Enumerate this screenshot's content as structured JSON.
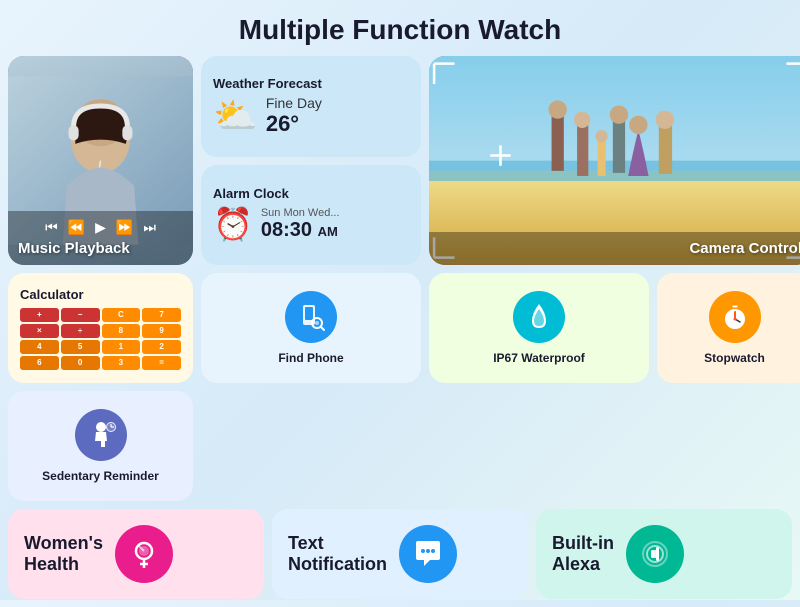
{
  "page": {
    "title": "Multiple Function Watch",
    "bg_color": "#e8f4fd"
  },
  "weather": {
    "title": "Weather Forecast",
    "condition": "Fine Day",
    "temperature": "26°",
    "icon": "⛅"
  },
  "alarm": {
    "title": "Alarm Clock",
    "days": "Sun Mon Wed...",
    "time": "08:30",
    "period": "AM",
    "icon": "⏰"
  },
  "music": {
    "label": "Music Playback",
    "controls": [
      "⏮",
      "⏪",
      "▶",
      "⏩",
      "⏭"
    ]
  },
  "camera": {
    "label": "Camera Control"
  },
  "calculator": {
    "title": "Calculator"
  },
  "find_phone": {
    "label": "Find Phone"
  },
  "waterproof": {
    "label": "IP67 Waterproof"
  },
  "stopwatch": {
    "label": "Stopwatch"
  },
  "sedentary": {
    "label": "Sedentary Reminder"
  },
  "womens_health": {
    "label_line1": "Women's",
    "label_line2": "Health"
  },
  "text_notification": {
    "label_line1": "Text",
    "label_line2": "Notification"
  },
  "builtin_alexa": {
    "label_line1": "Built-in",
    "label_line2": "Alexa"
  }
}
